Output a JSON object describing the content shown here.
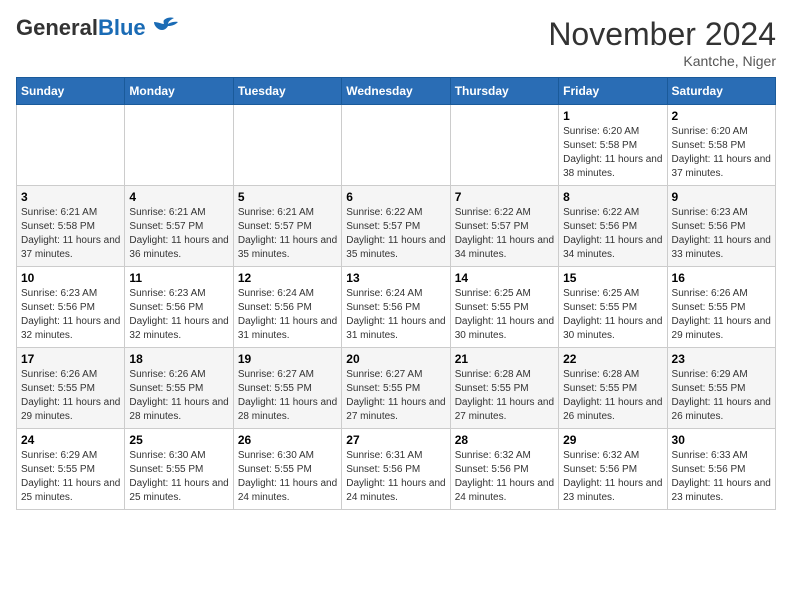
{
  "header": {
    "logo_general": "General",
    "logo_blue": "Blue",
    "month_title": "November 2024",
    "location": "Kantche, Niger"
  },
  "days_of_week": [
    "Sunday",
    "Monday",
    "Tuesday",
    "Wednesday",
    "Thursday",
    "Friday",
    "Saturday"
  ],
  "weeks": [
    [
      {
        "day": "",
        "info": ""
      },
      {
        "day": "",
        "info": ""
      },
      {
        "day": "",
        "info": ""
      },
      {
        "day": "",
        "info": ""
      },
      {
        "day": "",
        "info": ""
      },
      {
        "day": "1",
        "info": "Sunrise: 6:20 AM\nSunset: 5:58 PM\nDaylight: 11 hours and 38 minutes."
      },
      {
        "day": "2",
        "info": "Sunrise: 6:20 AM\nSunset: 5:58 PM\nDaylight: 11 hours and 37 minutes."
      }
    ],
    [
      {
        "day": "3",
        "info": "Sunrise: 6:21 AM\nSunset: 5:58 PM\nDaylight: 11 hours and 37 minutes."
      },
      {
        "day": "4",
        "info": "Sunrise: 6:21 AM\nSunset: 5:57 PM\nDaylight: 11 hours and 36 minutes."
      },
      {
        "day": "5",
        "info": "Sunrise: 6:21 AM\nSunset: 5:57 PM\nDaylight: 11 hours and 35 minutes."
      },
      {
        "day": "6",
        "info": "Sunrise: 6:22 AM\nSunset: 5:57 PM\nDaylight: 11 hours and 35 minutes."
      },
      {
        "day": "7",
        "info": "Sunrise: 6:22 AM\nSunset: 5:57 PM\nDaylight: 11 hours and 34 minutes."
      },
      {
        "day": "8",
        "info": "Sunrise: 6:22 AM\nSunset: 5:56 PM\nDaylight: 11 hours and 34 minutes."
      },
      {
        "day": "9",
        "info": "Sunrise: 6:23 AM\nSunset: 5:56 PM\nDaylight: 11 hours and 33 minutes."
      }
    ],
    [
      {
        "day": "10",
        "info": "Sunrise: 6:23 AM\nSunset: 5:56 PM\nDaylight: 11 hours and 32 minutes."
      },
      {
        "day": "11",
        "info": "Sunrise: 6:23 AM\nSunset: 5:56 PM\nDaylight: 11 hours and 32 minutes."
      },
      {
        "day": "12",
        "info": "Sunrise: 6:24 AM\nSunset: 5:56 PM\nDaylight: 11 hours and 31 minutes."
      },
      {
        "day": "13",
        "info": "Sunrise: 6:24 AM\nSunset: 5:56 PM\nDaylight: 11 hours and 31 minutes."
      },
      {
        "day": "14",
        "info": "Sunrise: 6:25 AM\nSunset: 5:55 PM\nDaylight: 11 hours and 30 minutes."
      },
      {
        "day": "15",
        "info": "Sunrise: 6:25 AM\nSunset: 5:55 PM\nDaylight: 11 hours and 30 minutes."
      },
      {
        "day": "16",
        "info": "Sunrise: 6:26 AM\nSunset: 5:55 PM\nDaylight: 11 hours and 29 minutes."
      }
    ],
    [
      {
        "day": "17",
        "info": "Sunrise: 6:26 AM\nSunset: 5:55 PM\nDaylight: 11 hours and 29 minutes."
      },
      {
        "day": "18",
        "info": "Sunrise: 6:26 AM\nSunset: 5:55 PM\nDaylight: 11 hours and 28 minutes."
      },
      {
        "day": "19",
        "info": "Sunrise: 6:27 AM\nSunset: 5:55 PM\nDaylight: 11 hours and 28 minutes."
      },
      {
        "day": "20",
        "info": "Sunrise: 6:27 AM\nSunset: 5:55 PM\nDaylight: 11 hours and 27 minutes."
      },
      {
        "day": "21",
        "info": "Sunrise: 6:28 AM\nSunset: 5:55 PM\nDaylight: 11 hours and 27 minutes."
      },
      {
        "day": "22",
        "info": "Sunrise: 6:28 AM\nSunset: 5:55 PM\nDaylight: 11 hours and 26 minutes."
      },
      {
        "day": "23",
        "info": "Sunrise: 6:29 AM\nSunset: 5:55 PM\nDaylight: 11 hours and 26 minutes."
      }
    ],
    [
      {
        "day": "24",
        "info": "Sunrise: 6:29 AM\nSunset: 5:55 PM\nDaylight: 11 hours and 25 minutes."
      },
      {
        "day": "25",
        "info": "Sunrise: 6:30 AM\nSunset: 5:55 PM\nDaylight: 11 hours and 25 minutes."
      },
      {
        "day": "26",
        "info": "Sunrise: 6:30 AM\nSunset: 5:55 PM\nDaylight: 11 hours and 24 minutes."
      },
      {
        "day": "27",
        "info": "Sunrise: 6:31 AM\nSunset: 5:56 PM\nDaylight: 11 hours and 24 minutes."
      },
      {
        "day": "28",
        "info": "Sunrise: 6:32 AM\nSunset: 5:56 PM\nDaylight: 11 hours and 24 minutes."
      },
      {
        "day": "29",
        "info": "Sunrise: 6:32 AM\nSunset: 5:56 PM\nDaylight: 11 hours and 23 minutes."
      },
      {
        "day": "30",
        "info": "Sunrise: 6:33 AM\nSunset: 5:56 PM\nDaylight: 11 hours and 23 minutes."
      }
    ]
  ]
}
